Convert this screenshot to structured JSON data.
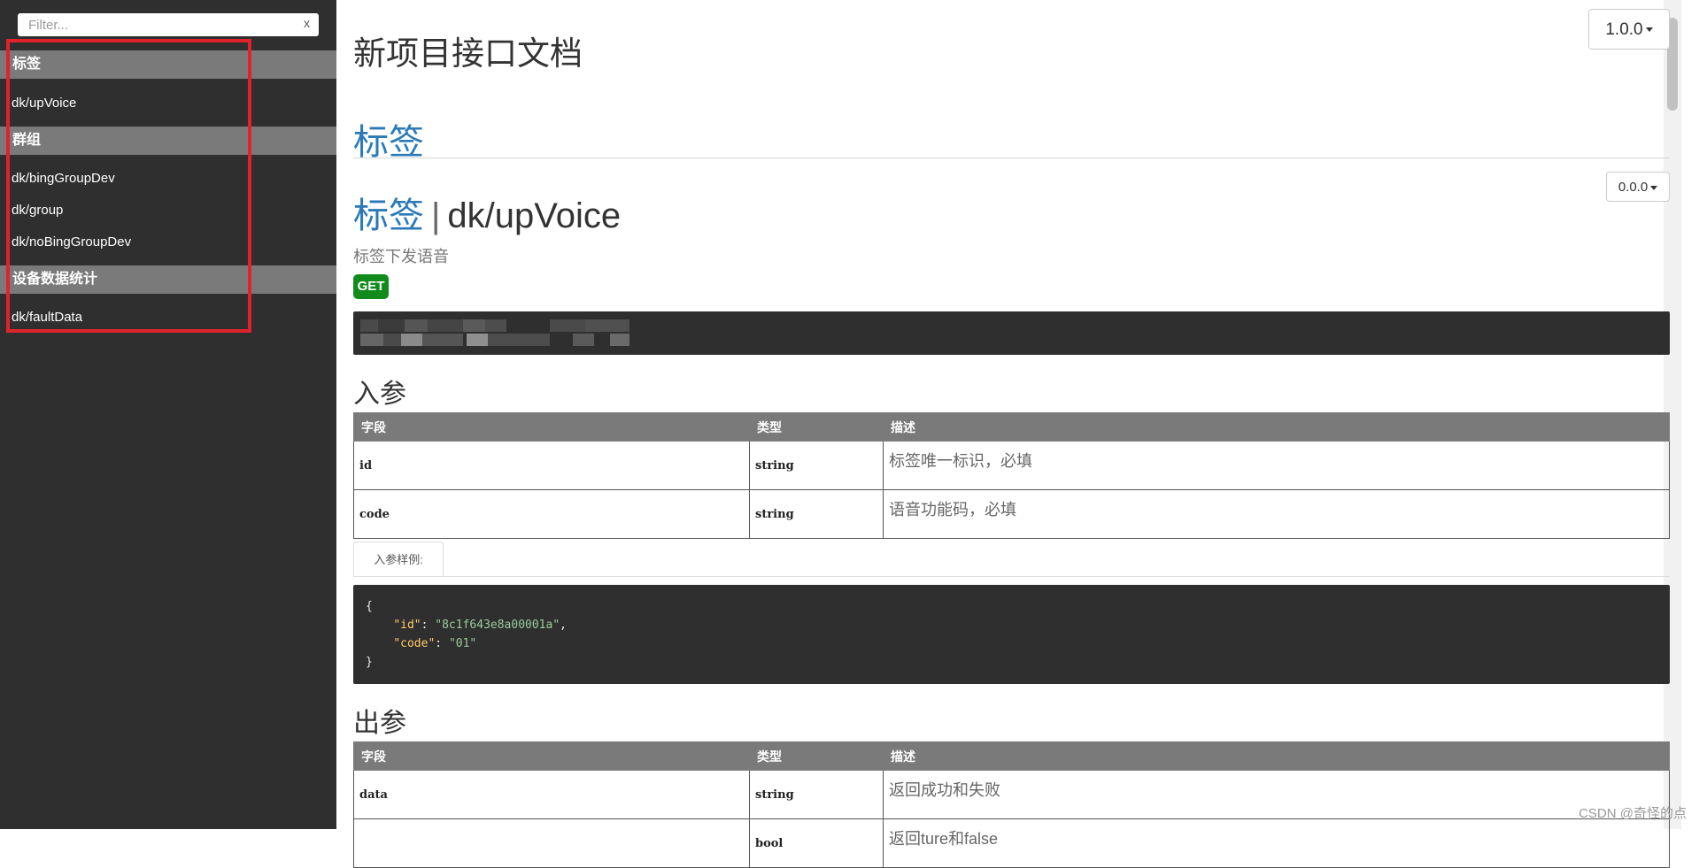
{
  "sidebar": {
    "filter_placeholder": "Filter...",
    "filter_clear": "x",
    "groups": [
      {
        "label": "标签",
        "items": [
          "dk/upVoice"
        ]
      },
      {
        "label": "群组",
        "items": [
          "dk/bingGroupDev",
          "dk/group",
          "dk/noBingGroupDev"
        ]
      },
      {
        "label": "设备数据统计",
        "items": [
          "dk/faultData"
        ]
      }
    ]
  },
  "header": {
    "title": "新项目接口文档",
    "version": "1.0.0"
  },
  "section": {
    "title": "标签"
  },
  "api": {
    "category": "标签",
    "separator": "|",
    "name": "dk/upVoice",
    "version": "0.0.0",
    "description": "标签下发语音",
    "method": "GET"
  },
  "input_params": {
    "title": "入参",
    "columns": [
      "字段",
      "类型",
      "描述"
    ],
    "rows": [
      {
        "field": "id",
        "type": "string",
        "desc": "标签唯一标识，必填"
      },
      {
        "field": "code",
        "type": "string",
        "desc": "语音功能码，必填"
      }
    ]
  },
  "example": {
    "tab_label": "入参样例:",
    "code": {
      "open": "{",
      "id_key": "\"id\"",
      "id_val": "\"8c1f643e8a00001a\"",
      "code_key": "\"code\"",
      "code_val": "\"01\"",
      "close": "}"
    }
  },
  "output_params": {
    "title": "出参",
    "columns": [
      "字段",
      "类型",
      "描述"
    ],
    "rows": [
      {
        "field": "data",
        "type": "string",
        "desc": "返回成功和失败"
      },
      {
        "field": "",
        "type": "bool",
        "desc": "返回ture和false"
      }
    ]
  },
  "watermark": "CSDN @奇怪的点",
  "colors": {
    "sidebar_bg": "#2f2f2f",
    "group_bg": "#7a7a7a",
    "accent": "#2a7ab8",
    "get_badge": "#118c1c",
    "highlight": "#e0232b"
  }
}
